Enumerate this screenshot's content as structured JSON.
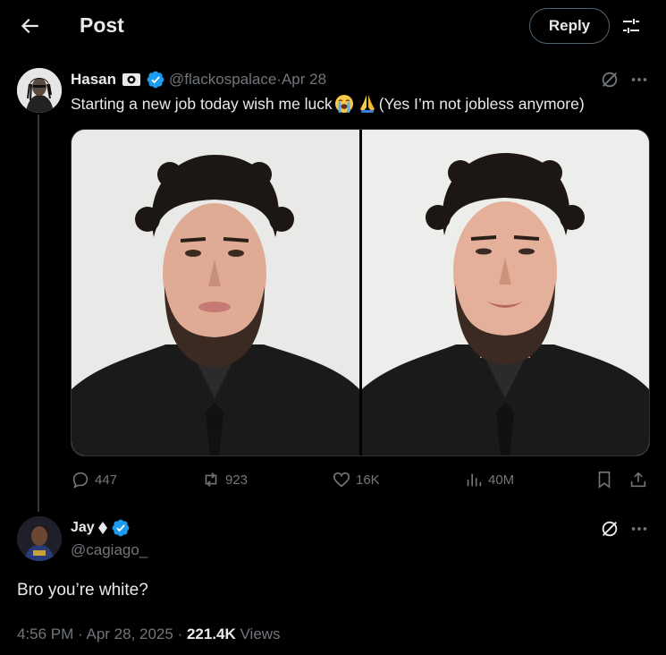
{
  "header": {
    "title": "Post",
    "reply_button": "Reply",
    "back_icon": "arrow-left-icon",
    "settings_icon": "sliders-icon"
  },
  "original_post": {
    "author_name": "Hasan",
    "handle": "@flackospalace",
    "separator": " · ",
    "date": "Apr 28",
    "text_part1": "Starting a new job today wish me luck ",
    "emojis": [
      "loudly-crying-face",
      "folded-hands"
    ],
    "text_part2": " (Yes I’m not jobless anymore)",
    "image_count": 2,
    "stats": {
      "replies": "447",
      "reposts": "923",
      "likes": "16K",
      "views": "40M"
    }
  },
  "reply_post": {
    "author_name": "Jay",
    "handle": "@cagiago_",
    "text": "Bro you’re white?",
    "time": "4:56 PM",
    "date_separator": " · ",
    "date": "Apr 28, 2025",
    "views_separator": " · ",
    "views_count": "221.4K",
    "views_label": " Views"
  },
  "colors": {
    "background": "#000000",
    "text": "#e7e9ea",
    "muted": "#71767b",
    "verified_blue": "#1d9bf0",
    "divider": "#2f3336"
  }
}
